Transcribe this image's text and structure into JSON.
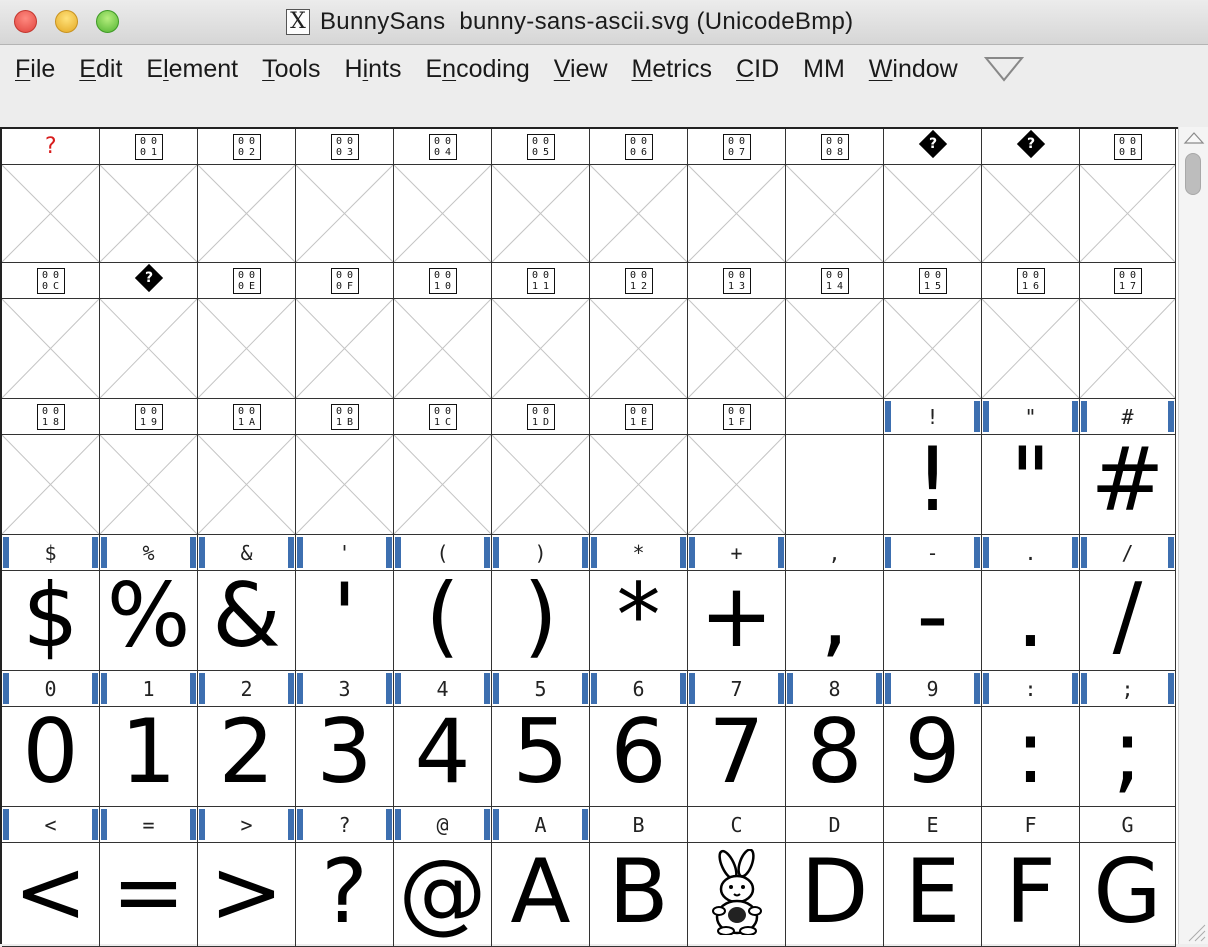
{
  "window": {
    "title_icon": "x-window-icon",
    "title": "BunnySans  bunny-sans-ascii.svg (UnicodeBmp)"
  },
  "menu": [
    {
      "pre": "",
      "u": "F",
      "post": "ile"
    },
    {
      "pre": "",
      "u": "E",
      "post": "dit"
    },
    {
      "pre": "E",
      "u": "l",
      "post": "ement"
    },
    {
      "pre": "",
      "u": "T",
      "post": "ools"
    },
    {
      "pre": "H",
      "u": "i",
      "post": "nts"
    },
    {
      "pre": "E",
      "u": "n",
      "post": "coding"
    },
    {
      "pre": "",
      "u": "V",
      "post": "iew"
    },
    {
      "pre": "",
      "u": "M",
      "post": "etrics"
    },
    {
      "pre": "",
      "u": "C",
      "post": "ID"
    },
    {
      "pre": "MM",
      "u": "",
      "post": ""
    },
    {
      "pre": "",
      "u": "W",
      "post": "indow"
    }
  ],
  "menu_overflow_icon": "triangle-down-icon",
  "colors": {
    "accent_marker": "#3d6fb0",
    "missing_label": "#d81c1c",
    "placeholder_cross": "#c4c4c4"
  },
  "grid": {
    "columns": 12,
    "cells": [
      {
        "label": "?",
        "label_kind": "red",
        "glyph": "",
        "status": "empty"
      },
      {
        "label": "0001",
        "label_kind": "hex",
        "glyph": "",
        "status": "empty"
      },
      {
        "label": "0002",
        "label_kind": "hex",
        "glyph": "",
        "status": "empty"
      },
      {
        "label": "0003",
        "label_kind": "hex",
        "glyph": "",
        "status": "empty"
      },
      {
        "label": "0004",
        "label_kind": "hex",
        "glyph": "",
        "status": "empty"
      },
      {
        "label": "0005",
        "label_kind": "hex",
        "glyph": "",
        "status": "empty"
      },
      {
        "label": "0006",
        "label_kind": "hex",
        "glyph": "",
        "status": "empty"
      },
      {
        "label": "0007",
        "label_kind": "hex",
        "glyph": "",
        "status": "empty"
      },
      {
        "label": "0008",
        "label_kind": "hex",
        "glyph": "",
        "status": "empty"
      },
      {
        "label": "?",
        "label_kind": "diamond",
        "glyph": "",
        "status": "empty"
      },
      {
        "label": "?",
        "label_kind": "diamond",
        "glyph": "",
        "status": "empty"
      },
      {
        "label": "000B",
        "label_kind": "hex",
        "glyph": "",
        "status": "empty"
      },
      {
        "label": "000C",
        "label_kind": "hex",
        "glyph": "",
        "status": "empty"
      },
      {
        "label": "?",
        "label_kind": "diamond",
        "glyph": "",
        "status": "empty"
      },
      {
        "label": "000E",
        "label_kind": "hex",
        "glyph": "",
        "status": "empty"
      },
      {
        "label": "000F",
        "label_kind": "hex",
        "glyph": "",
        "status": "empty"
      },
      {
        "label": "0010",
        "label_kind": "hex",
        "glyph": "",
        "status": "empty"
      },
      {
        "label": "0011",
        "label_kind": "hex",
        "glyph": "",
        "status": "empty"
      },
      {
        "label": "0012",
        "label_kind": "hex",
        "glyph": "",
        "status": "empty"
      },
      {
        "label": "0013",
        "label_kind": "hex",
        "glyph": "",
        "status": "empty"
      },
      {
        "label": "0014",
        "label_kind": "hex",
        "glyph": "",
        "status": "empty"
      },
      {
        "label": "0015",
        "label_kind": "hex",
        "glyph": "",
        "status": "empty"
      },
      {
        "label": "0016",
        "label_kind": "hex",
        "glyph": "",
        "status": "empty"
      },
      {
        "label": "0017",
        "label_kind": "hex",
        "glyph": "",
        "status": "empty"
      },
      {
        "label": "0018",
        "label_kind": "hex",
        "glyph": "",
        "status": "empty"
      },
      {
        "label": "0019",
        "label_kind": "hex",
        "glyph": "",
        "status": "empty"
      },
      {
        "label": "001A",
        "label_kind": "hex",
        "glyph": "",
        "status": "empty"
      },
      {
        "label": "001B",
        "label_kind": "hex",
        "glyph": "",
        "status": "empty"
      },
      {
        "label": "001C",
        "label_kind": "hex",
        "glyph": "",
        "status": "empty"
      },
      {
        "label": "001D",
        "label_kind": "hex",
        "glyph": "",
        "status": "empty"
      },
      {
        "label": "001E",
        "label_kind": "hex",
        "glyph": "",
        "status": "empty"
      },
      {
        "label": "001F",
        "label_kind": "hex",
        "glyph": "",
        "status": "empty"
      },
      {
        "label": "",
        "label_kind": "text",
        "glyph": "",
        "status": "blank"
      },
      {
        "label": "!",
        "label_kind": "text",
        "glyph": "!",
        "status": "filled"
      },
      {
        "label": "\"",
        "label_kind": "text",
        "glyph": "\"",
        "status": "filled"
      },
      {
        "label": "#",
        "label_kind": "text",
        "glyph": "#",
        "status": "filled"
      },
      {
        "label": "$",
        "label_kind": "text",
        "glyph": "$",
        "status": "filled"
      },
      {
        "label": "%",
        "label_kind": "text",
        "glyph": "%",
        "status": "filled"
      },
      {
        "label": "&",
        "label_kind": "text",
        "glyph": "&",
        "status": "filled"
      },
      {
        "label": "'",
        "label_kind": "text",
        "glyph": "'",
        "status": "filled"
      },
      {
        "label": "(",
        "label_kind": "text",
        "glyph": "(",
        "status": "filled"
      },
      {
        "label": ")",
        "label_kind": "text",
        "glyph": ")",
        "status": "filled"
      },
      {
        "label": "*",
        "label_kind": "text",
        "glyph": "*",
        "status": "filled"
      },
      {
        "label": "+",
        "label_kind": "text",
        "glyph": "+",
        "status": "filled"
      },
      {
        "label": ",",
        "label_kind": "text",
        "glyph": ",",
        "status": "plain"
      },
      {
        "label": "-",
        "label_kind": "text",
        "glyph": "-",
        "status": "filled"
      },
      {
        "label": ".",
        "label_kind": "text",
        "glyph": ".",
        "status": "filled"
      },
      {
        "label": "/",
        "label_kind": "text",
        "glyph": "/",
        "status": "filled"
      },
      {
        "label": "0",
        "label_kind": "text",
        "glyph": "0",
        "status": "filled"
      },
      {
        "label": "1",
        "label_kind": "text",
        "glyph": "1",
        "status": "filled"
      },
      {
        "label": "2",
        "label_kind": "text",
        "glyph": "2",
        "status": "filled"
      },
      {
        "label": "3",
        "label_kind": "text",
        "glyph": "3",
        "status": "filled"
      },
      {
        "label": "4",
        "label_kind": "text",
        "glyph": "4",
        "status": "filled"
      },
      {
        "label": "5",
        "label_kind": "text",
        "glyph": "5",
        "status": "filled"
      },
      {
        "label": "6",
        "label_kind": "text",
        "glyph": "6",
        "status": "filled"
      },
      {
        "label": "7",
        "label_kind": "text",
        "glyph": "7",
        "status": "filled"
      },
      {
        "label": "8",
        "label_kind": "text",
        "glyph": "8",
        "status": "filled"
      },
      {
        "label": "9",
        "label_kind": "text",
        "glyph": "9",
        "status": "filled"
      },
      {
        "label": ":",
        "label_kind": "text",
        "glyph": ":",
        "status": "filled"
      },
      {
        "label": ";",
        "label_kind": "text",
        "glyph": ";",
        "status": "filled"
      },
      {
        "label": "<",
        "label_kind": "text",
        "glyph": "<",
        "status": "filled"
      },
      {
        "label": "=",
        "label_kind": "text",
        "glyph": "=",
        "status": "filled"
      },
      {
        "label": ">",
        "label_kind": "text",
        "glyph": ">",
        "status": "filled"
      },
      {
        "label": "?",
        "label_kind": "text",
        "glyph": "?",
        "status": "filled"
      },
      {
        "label": "@",
        "label_kind": "text",
        "glyph": "@",
        "status": "filled"
      },
      {
        "label": "A",
        "label_kind": "text",
        "glyph": "A",
        "status": "filled"
      },
      {
        "label": "B",
        "label_kind": "text",
        "glyph": "B",
        "status": "plain"
      },
      {
        "label": "C",
        "label_kind": "text",
        "glyph": "",
        "glyph_icon": "bunny-icon",
        "status": "plain"
      },
      {
        "label": "D",
        "label_kind": "text",
        "glyph": "D",
        "status": "plain"
      },
      {
        "label": "E",
        "label_kind": "text",
        "glyph": "E",
        "status": "plain"
      },
      {
        "label": "F",
        "label_kind": "text",
        "glyph": "F",
        "status": "plain"
      },
      {
        "label": "G",
        "label_kind": "text",
        "glyph": "G",
        "status": "plain"
      }
    ]
  },
  "scrollbar": {
    "up_icon": "scroll-up-arrow-icon",
    "position": 0.0
  }
}
